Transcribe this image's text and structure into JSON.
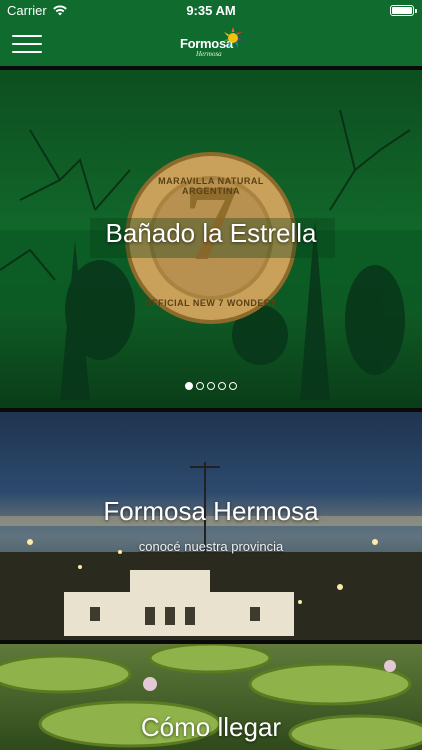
{
  "status_bar": {
    "carrier": "Carrier",
    "time": "9:35 AM"
  },
  "nav": {
    "logo_text": "Formosa",
    "logo_subtext": "Hermosa",
    "brand_color": "#0f6b2e"
  },
  "carousel": {
    "title": "Bañado la Estrella",
    "badge_text_top": "MARAVILLA NATURAL ARGENTINA",
    "badge_text_bottom": "OFFICIAL NEW 7 WONDERS",
    "badge_number": "7",
    "slide_count": 5,
    "active_slide": 1
  },
  "cards": [
    {
      "title": "Formosa Hermosa",
      "subtitle": "conocé nuestra provincia"
    },
    {
      "title": "Cómo llegar"
    }
  ]
}
